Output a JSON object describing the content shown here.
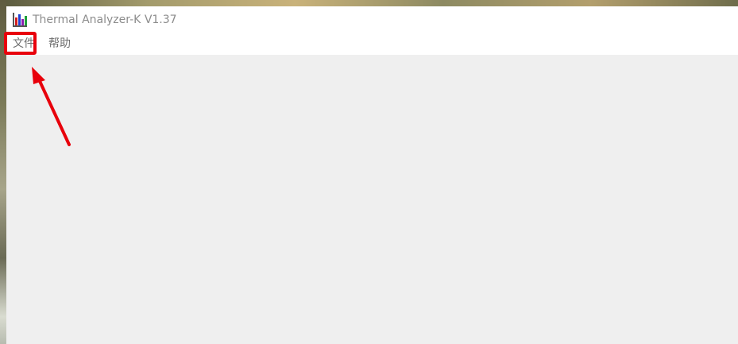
{
  "window": {
    "title": "Thermal Analyzer-K V1.37",
    "icon": "bar-chart-app-icon"
  },
  "menubar": {
    "items": [
      {
        "label": "文件"
      },
      {
        "label": "帮助"
      }
    ]
  },
  "annotation": {
    "highlight_color": "#e8000b",
    "highlight_target": "文件"
  },
  "colors": {
    "client_background": "#efefef",
    "titlebar_background": "#ffffff",
    "title_text": "#8c8c8c",
    "menu_text": "#6e6e6e"
  }
}
